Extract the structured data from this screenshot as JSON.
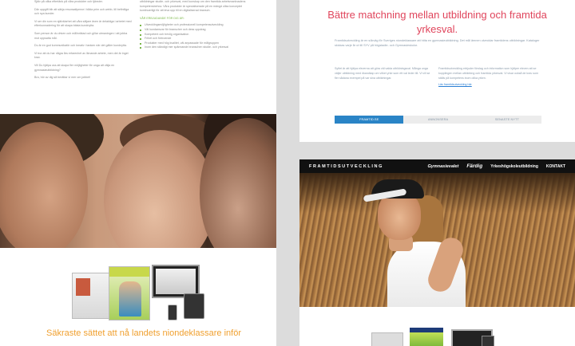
{
  "left_page": {
    "intro_col": [
      "Själv på olika eftertänk på våra produkter och tjänster.",
      "Där uppgift blir att säkja ersonsaltpmne i båda prim och webb, till befintliga och nya kunder.",
      "Vi ser din som en självklarhet att våra säljare även är delaktiga i arbetet med efterkunnadering för att skapa bästa kundnytta.",
      "Som person är du driven och målinriktad och gillar utmaningen i att jobba mot uppsatta mål.",
      "Du är en god kommunikatör och kreativ i tanken när det gäller kundnytta.",
      "Vi tror att du har några års erfarenhet av liknande arbete, men det är inget krav.",
      "Vill Du hjälpa oss att skapa fler möjligheter för unga att välja en gymnasieutbildning?"
    ],
    "intro_col_end": "Bra, hör av dig så berättar vi mer om jobbet!",
    "right_col": [
      "utbildningar studie- och yrkesval, med kunskap om den framtida arbetsmarknadens kompetensbehov. Våra produkter är specialiserade på en mängd olika konceptet kontinuerligt för att leva upp till en digitaliserad bransch."
    ],
    "green_heading": "VÅR ERBJUDANDE FÖR DIG ÄR:",
    "bullets": [
      "Utvecklingsmöjligheter och professionell kompetensutveckling",
      "Väl kundansvar för branscher och dess uppdrag",
      "Kompetent och trevlig organisation",
      "Frihet och förtroende",
      "Produkter med hög kvalitet, väl anpassade för målgruppen",
      "Inom den ständigt mer spännande branschen studie- och yrkesval"
    ],
    "heading_bottom": "Säkraste sättet att nå landets niondeklassare inför"
  },
  "right_page_1": {
    "title": "Bättre matchning mellan utbildning och framtida yrkesval.",
    "intro": "Framtidsutveckling är en sökväg för Sveriges niondeklassare att hitta en gymnasieutbildning. Det mål ämnen utvecklar framtidens utbildningar. Kataloger skickas varje år ut till SYV på högstadie- och Gymnasieskolor.",
    "col_a": "Syftet är att hjälpa eleverna att göra väl valda utbildningsval. Många unga väljer utbildning med ökandkap om vilket yrke som ett val leder till. Vi vill se fler sådana exempel på var sina utbildningar.",
    "col_b": "Framtidsutveckling erbjuder förslag och information som hjälper eleven att se kopplingen mellan utbildning och framtida yrkesval. Vi visar också de krav som ställs på kompetens inom olika yrken.",
    "link": "Läs framtidsutveckling här",
    "tabs": [
      "FRAMTID.SE",
      "ANNONSERA",
      "SENASTE NYTT"
    ],
    "active_tab": 0
  },
  "right_page_2": {
    "nav_brand": "FRAMTIDSUTVECKLING",
    "nav_items": [
      "Gymnasievalet",
      "Färdig",
      "Yrkeshögskoleutbildning",
      "KONTAKT"
    ]
  }
}
